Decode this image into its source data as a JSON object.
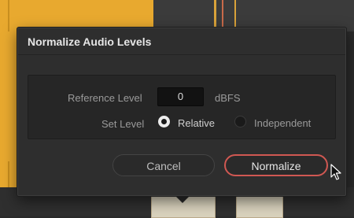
{
  "dialog": {
    "title": "Normalize Audio Levels",
    "reference_level_label": "Reference Level",
    "reference_level_value": "0",
    "unit_label": "dBFS",
    "set_level_label": "Set Level",
    "radio_options": [
      {
        "label": "Relative",
        "selected": true
      },
      {
        "label": "Independent",
        "selected": false
      }
    ],
    "cancel_label": "Cancel",
    "normalize_label": "Normalize"
  },
  "colors": {
    "accent_button_border": "#d05852",
    "clip_yellow": "#e8a92f"
  },
  "icons": {
    "cursor": "mouse-pointer-icon"
  }
}
